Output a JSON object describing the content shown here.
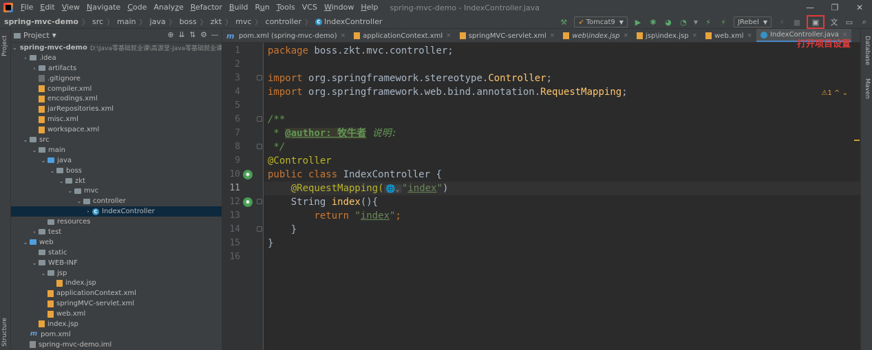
{
  "menu": {
    "items": [
      "File",
      "Edit",
      "View",
      "Navigate",
      "Code",
      "Analyze",
      "Refactor",
      "Build",
      "Run",
      "Tools",
      "VCS",
      "Window",
      "Help"
    ],
    "underline": [
      "F",
      "E",
      "V",
      "N",
      "C",
      "z",
      "R",
      "B",
      "u",
      "T",
      "",
      "W",
      "H"
    ],
    "window_title": "spring-mvc-demo - IndexController.java",
    "min": "—",
    "max": "❐",
    "close": "✕"
  },
  "breadcrumbs": [
    "spring-mvc-demo",
    "src",
    "main",
    "java",
    "boss",
    "zkt",
    "mvc",
    "controller",
    "IndexController"
  ],
  "toolbar": {
    "run_config": "Tomcat9",
    "jrebel": "JRebel",
    "annotation_label": "打开项目设置"
  },
  "project_panel": {
    "title": "Project",
    "root_name": "spring-mvc-demo",
    "root_path": "D:\\Java零基础就业课\\高源堂-Java零基础就业课\\",
    "tree": [
      {
        "depth": 1,
        "tw": "›",
        "icon": "folder",
        "label": ".idea"
      },
      {
        "depth": 2,
        "tw": "›",
        "icon": "folder",
        "label": "artifacts"
      },
      {
        "depth": 2,
        "tw": "",
        "icon": "git",
        "label": ".gitignore"
      },
      {
        "depth": 2,
        "tw": "",
        "icon": "xml",
        "label": "compiler.xml"
      },
      {
        "depth": 2,
        "tw": "",
        "icon": "xml",
        "label": "encodings.xml"
      },
      {
        "depth": 2,
        "tw": "",
        "icon": "xml",
        "label": "jarRepositories.xml"
      },
      {
        "depth": 2,
        "tw": "",
        "icon": "xml",
        "label": "misc.xml"
      },
      {
        "depth": 2,
        "tw": "",
        "icon": "xml",
        "label": "workspace.xml"
      },
      {
        "depth": 1,
        "tw": "⌄",
        "icon": "folder",
        "label": "src"
      },
      {
        "depth": 2,
        "tw": "⌄",
        "icon": "folder",
        "label": "main"
      },
      {
        "depth": 3,
        "tw": "⌄",
        "icon": "blue",
        "label": "java"
      },
      {
        "depth": 4,
        "tw": "⌄",
        "icon": "folder",
        "label": "boss"
      },
      {
        "depth": 5,
        "tw": "⌄",
        "icon": "folder",
        "label": "zkt"
      },
      {
        "depth": 6,
        "tw": "⌄",
        "icon": "folder",
        "label": "mvc"
      },
      {
        "depth": 7,
        "tw": "⌄",
        "icon": "folder",
        "label": "controller"
      },
      {
        "depth": 8,
        "tw": "›",
        "icon": "class",
        "label": "IndexController",
        "selected": true
      },
      {
        "depth": 3,
        "tw": "",
        "icon": "res",
        "label": "resources"
      },
      {
        "depth": 2,
        "tw": "›",
        "icon": "folder",
        "label": "test"
      },
      {
        "depth": 1,
        "tw": "⌄",
        "icon": "blue",
        "label": "web"
      },
      {
        "depth": 2,
        "tw": "",
        "icon": "folder",
        "label": "static"
      },
      {
        "depth": 2,
        "tw": "⌄",
        "icon": "folder",
        "label": "WEB-INF"
      },
      {
        "depth": 3,
        "tw": "⌄",
        "icon": "folder",
        "label": "jsp"
      },
      {
        "depth": 4,
        "tw": "",
        "icon": "jsp",
        "label": "index.jsp"
      },
      {
        "depth": 3,
        "tw": "",
        "icon": "xml",
        "label": "applicationContext.xml"
      },
      {
        "depth": 3,
        "tw": "",
        "icon": "xml",
        "label": "springMVC-servlet.xml"
      },
      {
        "depth": 3,
        "tw": "",
        "icon": "xml",
        "label": "web.xml"
      },
      {
        "depth": 2,
        "tw": "",
        "icon": "jsp",
        "label": "index.jsp"
      },
      {
        "depth": 1,
        "tw": "",
        "icon": "m",
        "label": "pom.xml"
      },
      {
        "depth": 1,
        "tw": "",
        "icon": "iml",
        "label": "spring-mvc-demo.iml"
      }
    ]
  },
  "tabs": [
    {
      "label": "pom.xml (spring-mvc-demo)",
      "icon": "m"
    },
    {
      "label": "applicationContext.xml",
      "icon": "xml"
    },
    {
      "label": "springMVC-servlet.xml",
      "icon": "xml"
    },
    {
      "label": "web\\index.jsp",
      "icon": "xml",
      "italic": true
    },
    {
      "label": "jsp\\index.jsp",
      "icon": "xml"
    },
    {
      "label": "web.xml",
      "icon": "xml"
    },
    {
      "label": "IndexController.java",
      "icon": "cls",
      "active": true
    }
  ],
  "editor": {
    "line_numbers": [
      "1",
      "2",
      "3",
      "4",
      "5",
      "6",
      "7",
      "8",
      "9",
      "10",
      "11",
      "12",
      "13",
      "14",
      "15",
      "16"
    ],
    "current_line": 11,
    "inspection": "⚠1 ^ ⌄",
    "code": {
      "l1_kw": "package ",
      "l1_rest": "boss.zkt.mvc.controller;",
      "l3_kw": "import ",
      "l3_pkg": "org.springframework.stereotype.",
      "l3_cls": "Controller",
      "l3_end": ";",
      "l4_kw": "import ",
      "l4_pkg": "org.springframework.web.bind.annotation.",
      "l4_cls": "RequestMapping",
      "l4_end": ";",
      "l6": "/**",
      "l7_star": " * ",
      "l7_tag": "@author: 牧牛者",
      "l7_rest": " 说明:",
      "l8": " */",
      "l9": "@Controller",
      "l10_kw": "public class ",
      "l10_rest": "IndexController {",
      "l11_ann": "    @RequestMapping(",
      "l11_hint": "🌐⌄",
      "l11_q1": "\"",
      "l11_val": "index",
      "l11_q2": "\"",
      "l11_end": ")",
      "l12_type": "    String ",
      "l12_fn": "index",
      "l12_end": "(){",
      "l13_kw": "        return ",
      "l13_q1": "\"",
      "l13_val": "index",
      "l13_q2": "\"",
      "l13_end": ";",
      "l14": "    }",
      "l15": "}"
    }
  },
  "side_labels": {
    "left_top": "Project",
    "left_bottom": "Structure",
    "right_top": "Database",
    "right_mid": "Maven"
  }
}
